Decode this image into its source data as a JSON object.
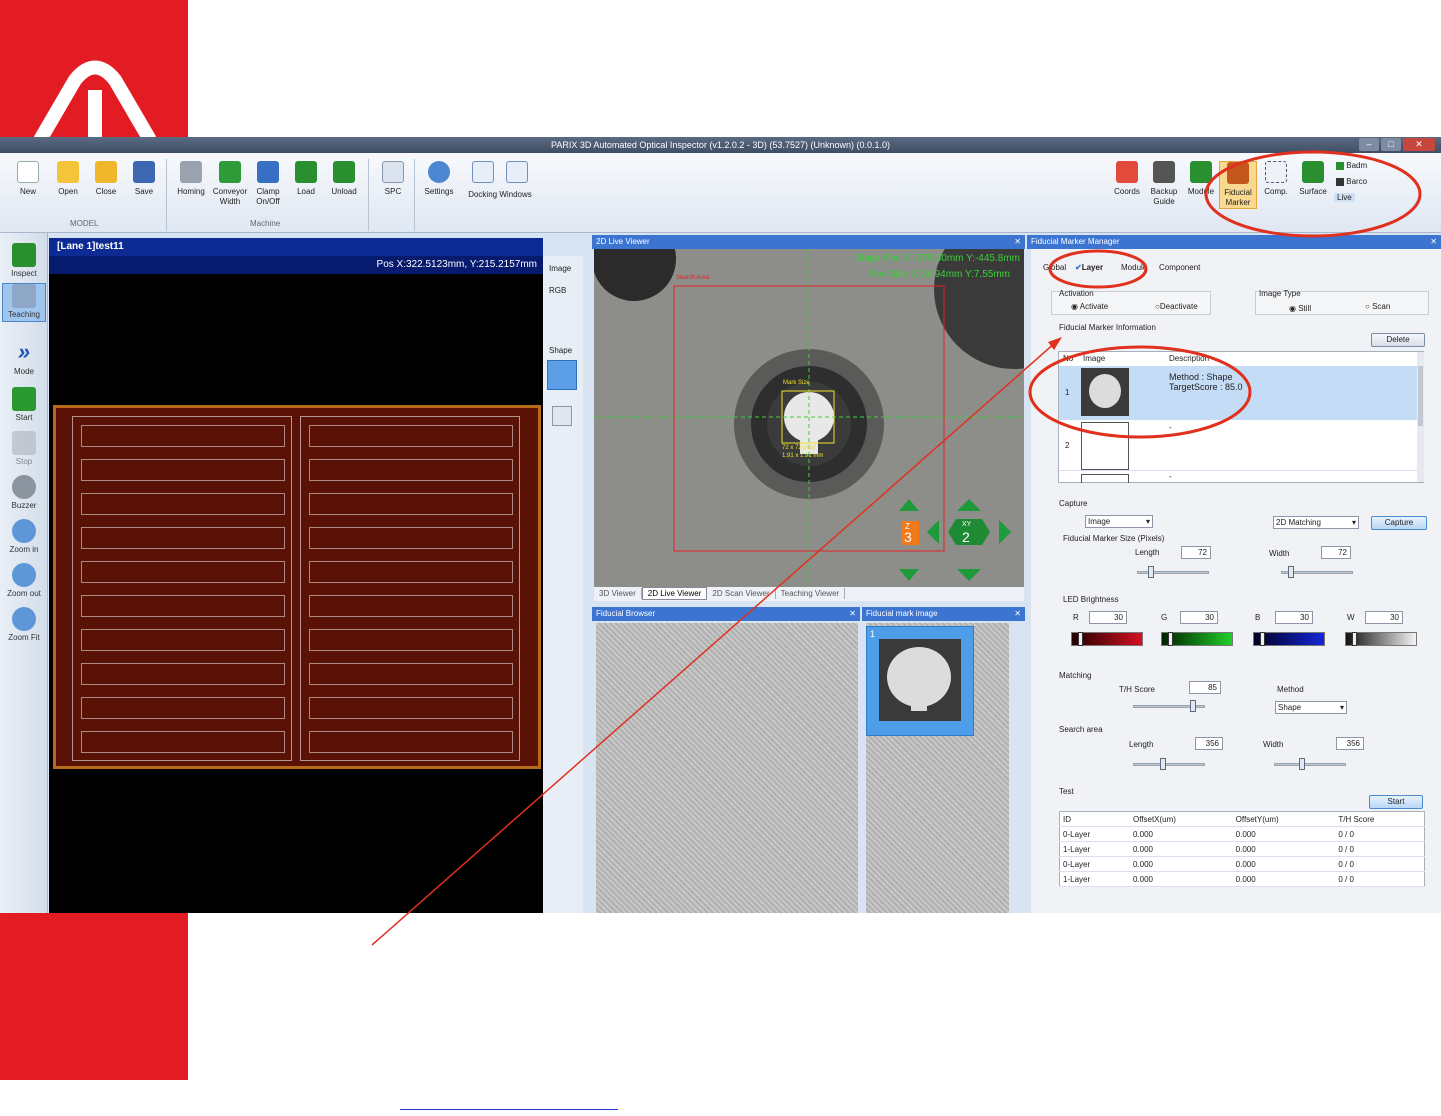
{
  "app": {
    "title": "PARIX 3D Automated Optical Inspector (v1.2.0.2 - 3D) (53.7527) (Unknown) (0.0.1.0)",
    "window_buttons": [
      "–",
      "□",
      "✕"
    ]
  },
  "colors": {
    "brand_red": "#e31c24",
    "panel_header": "#3b74d1",
    "lane_header": "#0d2b92",
    "annotation": "#e0301e"
  },
  "ribbon": {
    "model_buttons": [
      {
        "label": "New",
        "icon": "new-file-icon"
      },
      {
        "label": "Open",
        "icon": "folder-open-icon"
      },
      {
        "label": "Close",
        "icon": "folder-close-icon"
      },
      {
        "label": "Save",
        "icon": "floppy-icon"
      }
    ],
    "model_group": "MODEL",
    "machine_buttons": [
      {
        "label": "Homing",
        "icon": "homing-icon"
      },
      {
        "label": "Conveyor\nWidth",
        "icon": "conveyor-icon"
      },
      {
        "label": "Clamp\nOn/Off",
        "icon": "clamp-icon"
      },
      {
        "label": "Load",
        "icon": "load-icon"
      },
      {
        "label": "Unload",
        "icon": "unload-icon"
      }
    ],
    "machine_group": "Machine",
    "spc_label": "SPC",
    "settings_label": "Settings",
    "docking_label": "Docking Windows",
    "right_buttons": [
      {
        "label": "Coords",
        "icon": "coords-icon"
      },
      {
        "label": "Backup\nGuide",
        "icon": "backup-icon"
      },
      {
        "label": "Module",
        "icon": "module-icon"
      },
      {
        "label": "Fiducial\nMarker",
        "icon": "fiducial-icon"
      },
      {
        "label": "Comp.",
        "icon": "component-icon"
      },
      {
        "label": "Surface",
        "icon": "surface-icon"
      }
    ],
    "small_buttons": [
      "Badm",
      "Barco",
      "Live"
    ]
  },
  "left_toolbar": [
    {
      "label": "Inspect",
      "icon": "inspect-icon"
    },
    {
      "label": "Teaching",
      "icon": "teaching-icon"
    },
    {
      "label": "Mode",
      "icon": "mode-icon"
    },
    {
      "label": "Start",
      "icon": "start-icon"
    },
    {
      "label": "Stop",
      "icon": "stop-icon"
    },
    {
      "label": "Buzzer",
      "icon": "buzzer-icon"
    },
    {
      "label": "Zoom in",
      "icon": "zoom-in-icon"
    },
    {
      "label": "Zoom out",
      "icon": "zoom-out-icon"
    },
    {
      "label": "Zoom Fit",
      "icon": "zoom-fit-icon"
    }
  ],
  "lane": {
    "title": "[Lane 1]test11",
    "pos": "Pos X:322.5123mm, Y:215.2157mm",
    "image_label": "Image",
    "rgb_label": "RGB",
    "shape_label": "Shape"
  },
  "live_viewer": {
    "title": "2D Live Viewer",
    "coords1": "Stage Pos X:-275.30mm Y:-445.8mm",
    "coords2": "Fov Size X:24.94mm Y:7.55mm",
    "search_area": "Search Area",
    "mark_size": "Mark Size",
    "mark_dim1": "72 x 72 pixel",
    "mark_dim2": "1.91 x 1.91 mm",
    "z_label": "Z",
    "z_value": "3",
    "xy_label": "XY",
    "xy_value": "2",
    "tabs": [
      "3D Viewer",
      "2D Live Viewer",
      "2D Scan Viewer",
      "Teaching Viewer"
    ]
  },
  "fiducial_browser": {
    "title": "Fiducial Browser"
  },
  "fiducial_mark_image": {
    "title": "Fiducial mark image",
    "index": "1"
  },
  "manager": {
    "title": "Fiducial Marker Manager",
    "tabs": [
      "Global",
      "Layer",
      "Module",
      "Component"
    ],
    "activation_label": "Activation",
    "activate": "Activate",
    "deactivate": "Deactivate",
    "image_type_label": "Image Type",
    "still": "Still",
    "scan": "Scan",
    "info_label": "Fiducial Marker Information",
    "delete": "Delete",
    "list_headers": [
      "No",
      "Image",
      "Description"
    ],
    "list": [
      {
        "no": "1",
        "desc1": "Method : Shape",
        "desc2": "TargetScore : 85.0"
      },
      {
        "no": "2",
        "desc1": "-",
        "desc2": ""
      },
      {
        "no": "",
        "desc1": "-",
        "desc2": ""
      }
    ],
    "capture_label": "Capture",
    "capture_source": "Image",
    "capture_mode": "2D Matching",
    "capture_btn": "Capture",
    "size_label": "Fiducial Marker Size (Pixels)",
    "length_label": "Length",
    "length_value": "72",
    "width_label": "Width",
    "width_value": "72",
    "led_label": "LED Brightness",
    "led": [
      {
        "ch": "R",
        "value": "30"
      },
      {
        "ch": "G",
        "value": "30"
      },
      {
        "ch": "B",
        "value": "30"
      },
      {
        "ch": "W",
        "value": "30"
      }
    ],
    "matching_label": "Matching",
    "th_label": "T/H Score",
    "th_value": "85",
    "method_label": "Method",
    "method_value": "Shape",
    "search_label": "Search area",
    "search_length_label": "Length",
    "search_length": "356",
    "search_width_label": "Width",
    "search_width": "356",
    "test_label": "Test",
    "start": "Start",
    "result_headers": [
      "ID",
      "OffsetX(um)",
      "OffsetY(um)",
      "T/H Score"
    ],
    "results": [
      [
        "0-Layer",
        "0.000",
        "0.000",
        "0 / 0"
      ],
      [
        "1-Layer",
        "0.000",
        "0.000",
        "0 / 0"
      ],
      [
        "0-Layer",
        "0.000",
        "0.000",
        "0 / 0"
      ],
      [
        "1-Layer",
        "0.000",
        "0.000",
        "0 / 0"
      ]
    ]
  }
}
